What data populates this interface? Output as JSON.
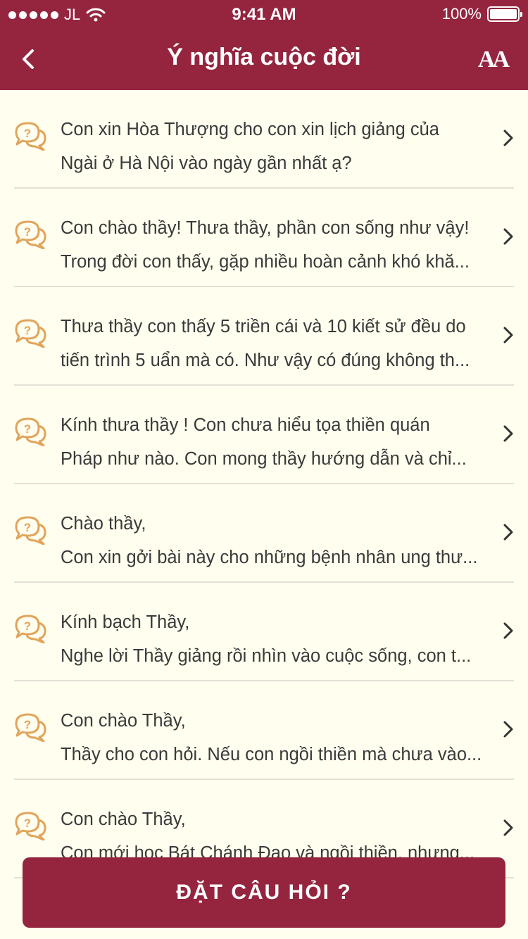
{
  "status_bar": {
    "carrier": "JL",
    "time": "9:41 AM",
    "battery": "100%"
  },
  "header": {
    "title": "Ý nghĩa cuộc đời",
    "font_size_label": "AA"
  },
  "questions": [
    {
      "line1": "Con xin Hòa Thượng cho con xin lịch giảng của",
      "line2": "Ngài ở Hà Nội vào ngày gần nhất ạ?"
    },
    {
      "line1": "Con chào thầy! Thưa thầy, phần con sống như vậy!",
      "line2": "Trong đời con thấy, gặp nhiều hoàn cảnh khó khă..."
    },
    {
      "line1": "Thưa thầy con thấy 5 triền cái và 10 kiết sử đều do",
      "line2": "tiến trình 5 uẩn mà có. Như vậy có đúng không th..."
    },
    {
      "line1": "Kính thưa thầy ! Con chưa hiểu tọa thiền quán",
      "line2": "Pháp như nào. Con mong thầy hướng dẫn và chỉ..."
    },
    {
      "line1": "Chào thầy,",
      "line2": "Con xin gởi bài này cho những bệnh nhân ung thư..."
    },
    {
      "line1": "Kính bạch Thầy,",
      "line2": "Nghe lời Thầy giảng rồi nhìn vào cuộc sống, con t..."
    },
    {
      "line1": "Con chào Thầy,",
      "line2": "Thầy cho con hỏi. Nếu con ngồi thiền mà chưa vào..."
    },
    {
      "line1": "Con chào Thầy,",
      "line2": "Con mới học Bát Chánh Đạo và ngồi thiền, nhưng..."
    }
  ],
  "ask_button": {
    "label": "ĐẶT CÂU HỎI ?"
  },
  "colors": {
    "primary": "#95253F",
    "background": "#FFFEEF",
    "icon": "#E2A45A",
    "text": "#3A3A3A"
  },
  "icons": {
    "back": "chevron-left-icon",
    "font": "font-size-icon",
    "question": "question-bubble-icon",
    "row": "chevron-right-icon"
  }
}
